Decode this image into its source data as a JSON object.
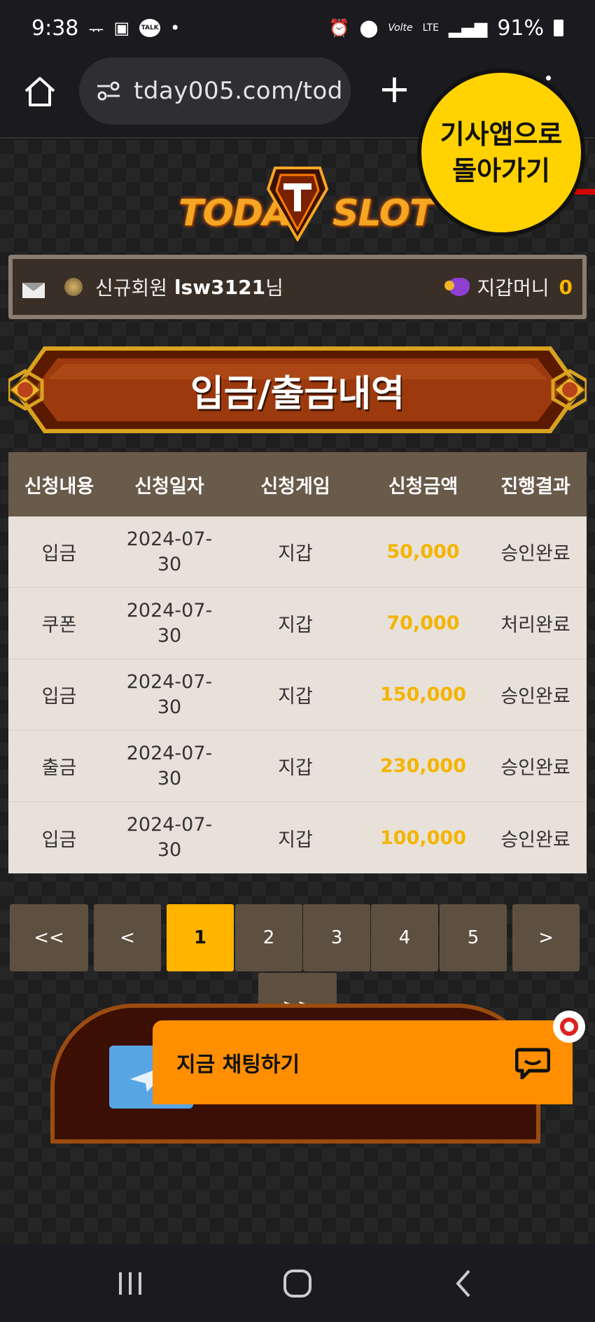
{
  "status_bar": {
    "time": "9:38",
    "talk_badge": "TALK",
    "network": "LTE",
    "volte": "Volte",
    "battery": "91%"
  },
  "browser": {
    "url": "tday005.com/tod",
    "back_bubble": "기사앱으로\n돌아가기"
  },
  "logo": {
    "left_word": "TODAY",
    "right_word": "SLOT"
  },
  "user_bar": {
    "label": "신규회원",
    "username": "lsw3121",
    "suffix": "님",
    "wallet_label": "지갑머니",
    "wallet_value": "0"
  },
  "banner": {
    "title": "입금/출금내역"
  },
  "table": {
    "headers": [
      "신청내용",
      "신청일자",
      "신청게임",
      "신청금액",
      "진행결과"
    ],
    "rows": [
      [
        "입금",
        "2024-07-\n30",
        "지갑",
        "50,000",
        "승인완료"
      ],
      [
        "쿠폰",
        "2024-07-\n30",
        "지갑",
        "70,000",
        "처리완료"
      ],
      [
        "입금",
        "2024-07-\n30",
        "지갑",
        "150,000",
        "승인완료"
      ],
      [
        "출금",
        "2024-07-\n30",
        "지갑",
        "230,000",
        "승인완료"
      ],
      [
        "입금",
        "2024-07-\n30",
        "지갑",
        "100,000",
        "승인완료"
      ]
    ]
  },
  "pagination": {
    "first": "<<",
    "prev": "<",
    "pages": [
      "1",
      "2",
      "3",
      "4",
      "5"
    ],
    "current": "1",
    "next": ">",
    "last": ">>"
  },
  "chat": {
    "label": "지금 채팅하기"
  },
  "colors": {
    "accent": "#ffb400",
    "header_bg": "#695a4a",
    "row_bg": "#e7e1d9",
    "chat_orange": "#ff8f00",
    "bubble_yellow": "#ffd200"
  }
}
